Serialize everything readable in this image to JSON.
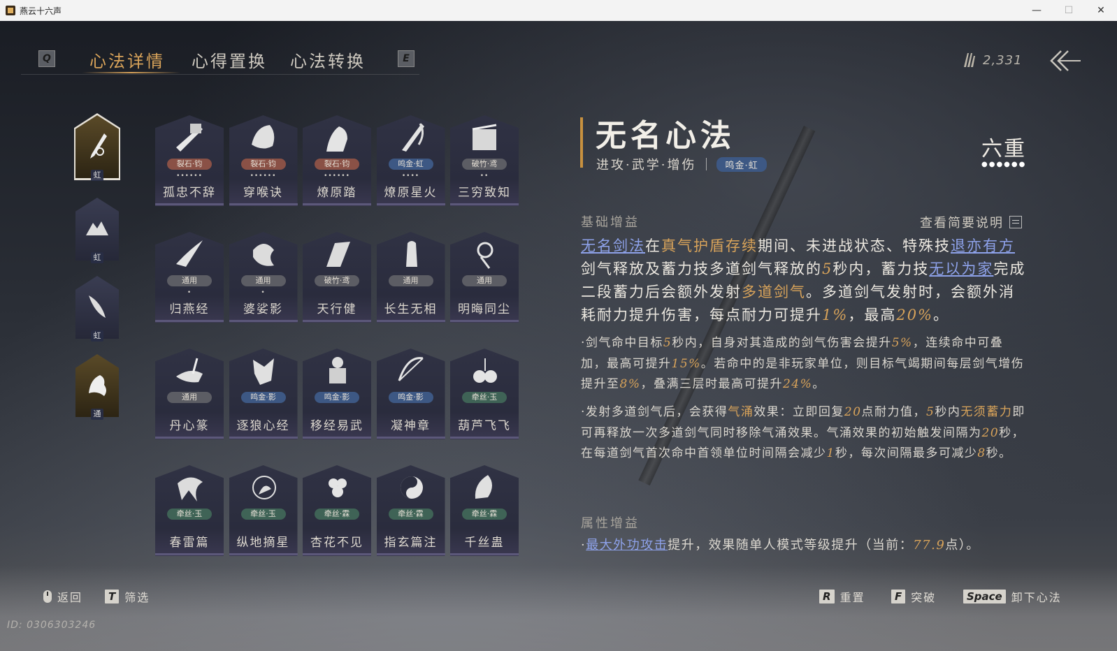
{
  "window": {
    "title": "燕云十六声",
    "controls": [
      "—",
      "☐",
      "✕"
    ]
  },
  "tabs": {
    "left_key": "Q",
    "right_key": "E",
    "items": [
      {
        "label": "心法详情",
        "active": true
      },
      {
        "label": "心得置换",
        "active": false
      },
      {
        "label": "心法转换",
        "active": false
      }
    ]
  },
  "currency": {
    "value": "2,331"
  },
  "characters": [
    {
      "badge": "虹",
      "selected": true
    },
    {
      "badge": "虹",
      "selected": false
    },
    {
      "badge": "虹",
      "selected": false
    },
    {
      "badge": "通",
      "selected": false
    }
  ],
  "cards": [
    {
      "name": "孤忠不辞",
      "tag": "裂石·钧",
      "tag_color": "rust",
      "dots": "••••••"
    },
    {
      "name": "穿喉诀",
      "tag": "裂石·钧",
      "tag_color": "rust",
      "dots": "••••••"
    },
    {
      "name": "燎原踏",
      "tag": "裂石·钧",
      "tag_color": "rust",
      "dots": "••••••"
    },
    {
      "name": "燎原星火",
      "tag": "鸣金·虹",
      "tag_color": "blue",
      "dots": "••••"
    },
    {
      "name": "三穷致知",
      "tag": "破竹·鸢",
      "tag_color": "gray",
      "dots": "••"
    },
    {
      "name": "归燕经",
      "tag": "通用",
      "tag_color": "gray",
      "dots": "•"
    },
    {
      "name": "婆娑影",
      "tag": "通用",
      "tag_color": "gray",
      "dots": "•"
    },
    {
      "name": "天行健",
      "tag": "破竹·鸢",
      "tag_color": "gray",
      "dots": ""
    },
    {
      "name": "长生无相",
      "tag": "通用",
      "tag_color": "gray",
      "dots": ""
    },
    {
      "name": "明晦同尘",
      "tag": "通用",
      "tag_color": "gray",
      "dots": ""
    },
    {
      "name": "丹心篆",
      "tag": "通用",
      "tag_color": "gray",
      "dots": ""
    },
    {
      "name": "逐狼心经",
      "tag": "鸣金·影",
      "tag_color": "blue",
      "dots": ""
    },
    {
      "name": "移经易武",
      "tag": "鸣金·影",
      "tag_color": "blue",
      "dots": ""
    },
    {
      "name": "凝神章",
      "tag": "鸣金·影",
      "tag_color": "blue",
      "dots": ""
    },
    {
      "name": "葫芦飞飞",
      "tag": "牵丝·玉",
      "tag_color": "green",
      "dots": ""
    },
    {
      "name": "春雷篇",
      "tag": "牵丝·玉",
      "tag_color": "green",
      "dots": ""
    },
    {
      "name": "纵地摘星",
      "tag": "牵丝·玉",
      "tag_color": "green",
      "dots": ""
    },
    {
      "name": "杏花不见",
      "tag": "牵丝·霖",
      "tag_color": "green",
      "dots": ""
    },
    {
      "name": "指玄篇注",
      "tag": "牵丝·霖",
      "tag_color": "green",
      "dots": ""
    },
    {
      "name": "千丝蛊",
      "tag": "牵丝·霖",
      "tag_color": "green",
      "dots": ""
    }
  ],
  "detail": {
    "title": "无名心法",
    "subtitle": "进攻·武学·增伤",
    "pill": "鸣金·虹",
    "level": "六重",
    "level_dots": "●●●●●●",
    "base_label": "基础增益",
    "view_desc": "查看简要说明",
    "main_parts": [
      {
        "t": "无名剑法",
        "s": "link"
      },
      {
        "t": "在",
        "s": ""
      },
      {
        "t": "真气护盾存续",
        "s": "gold"
      },
      {
        "t": "期间、未进战状态、特殊技",
        "s": ""
      },
      {
        "t": "退亦有方",
        "s": "link"
      },
      {
        "t": "剑气释放及蓄力技多道剑气释放的",
        "s": ""
      },
      {
        "t": "5",
        "s": "num"
      },
      {
        "t": "秒内，蓄力技",
        "s": ""
      },
      {
        "t": "无以为家",
        "s": "link"
      },
      {
        "t": "完成二段蓄力后会额外发射",
        "s": ""
      },
      {
        "t": "多道剑气",
        "s": "gold"
      },
      {
        "t": "。多道剑气发射时，会额外消耗耐力提升伤害，每点耐力可提升",
        "s": ""
      },
      {
        "t": "1%",
        "s": "num"
      },
      {
        "t": "，最高",
        "s": ""
      },
      {
        "t": "20%",
        "s": "num"
      },
      {
        "t": "。",
        "s": ""
      }
    ],
    "bullet1_parts": [
      {
        "t": "·剑气命中目标",
        "s": ""
      },
      {
        "t": "5",
        "s": "num"
      },
      {
        "t": "秒内，自身对其造成的剑气伤害会提升",
        "s": ""
      },
      {
        "t": "5%",
        "s": "num"
      },
      {
        "t": "，连续命中可叠加，最高可提升",
        "s": ""
      },
      {
        "t": "15%",
        "s": "num"
      },
      {
        "t": "。若命中的是非玩家单位，则目标气竭期间每层剑气增伤提升至",
        "s": ""
      },
      {
        "t": "8%",
        "s": "num"
      },
      {
        "t": "，叠满三层时最高可提升",
        "s": ""
      },
      {
        "t": "24%",
        "s": "num"
      },
      {
        "t": "。",
        "s": ""
      }
    ],
    "bullet2_parts": [
      {
        "t": "·发射多道剑气后，会获得",
        "s": ""
      },
      {
        "t": "气涌",
        "s": "gold"
      },
      {
        "t": "效果：立即回复",
        "s": ""
      },
      {
        "t": "20",
        "s": "num"
      },
      {
        "t": "点耐力值，",
        "s": ""
      },
      {
        "t": "5",
        "s": "num"
      },
      {
        "t": "秒内",
        "s": ""
      },
      {
        "t": "无须蓄力",
        "s": "gold"
      },
      {
        "t": "即可再释放一次多道剑气同时移除气涌效果。气涌效果的初始触发间隔为",
        "s": ""
      },
      {
        "t": "20",
        "s": "num"
      },
      {
        "t": "秒，在每道剑气首次命中首领单位时间隔会减少",
        "s": ""
      },
      {
        "t": "1",
        "s": "num"
      },
      {
        "t": "秒，每次间隔最多可减少",
        "s": ""
      },
      {
        "t": "8",
        "s": "num"
      },
      {
        "t": "秒。",
        "s": ""
      }
    ],
    "attr_label": "属性增益",
    "attr_parts": [
      {
        "t": "·",
        "s": ""
      },
      {
        "t": "最大外功攻击",
        "s": "link"
      },
      {
        "t": "提升，效果随单人模式等级提升（当前：",
        "s": ""
      },
      {
        "t": "77.9",
        "s": "num"
      },
      {
        "t": "点）。",
        "s": ""
      }
    ]
  },
  "bottom": {
    "back": "返回",
    "filter_key": "T",
    "filter": "筛选",
    "reset_key": "R",
    "reset": "重置",
    "break_key": "F",
    "break": "突破",
    "unload_key": "Space",
    "unload": "卸下心法"
  },
  "uid": "ID: 0306303246"
}
